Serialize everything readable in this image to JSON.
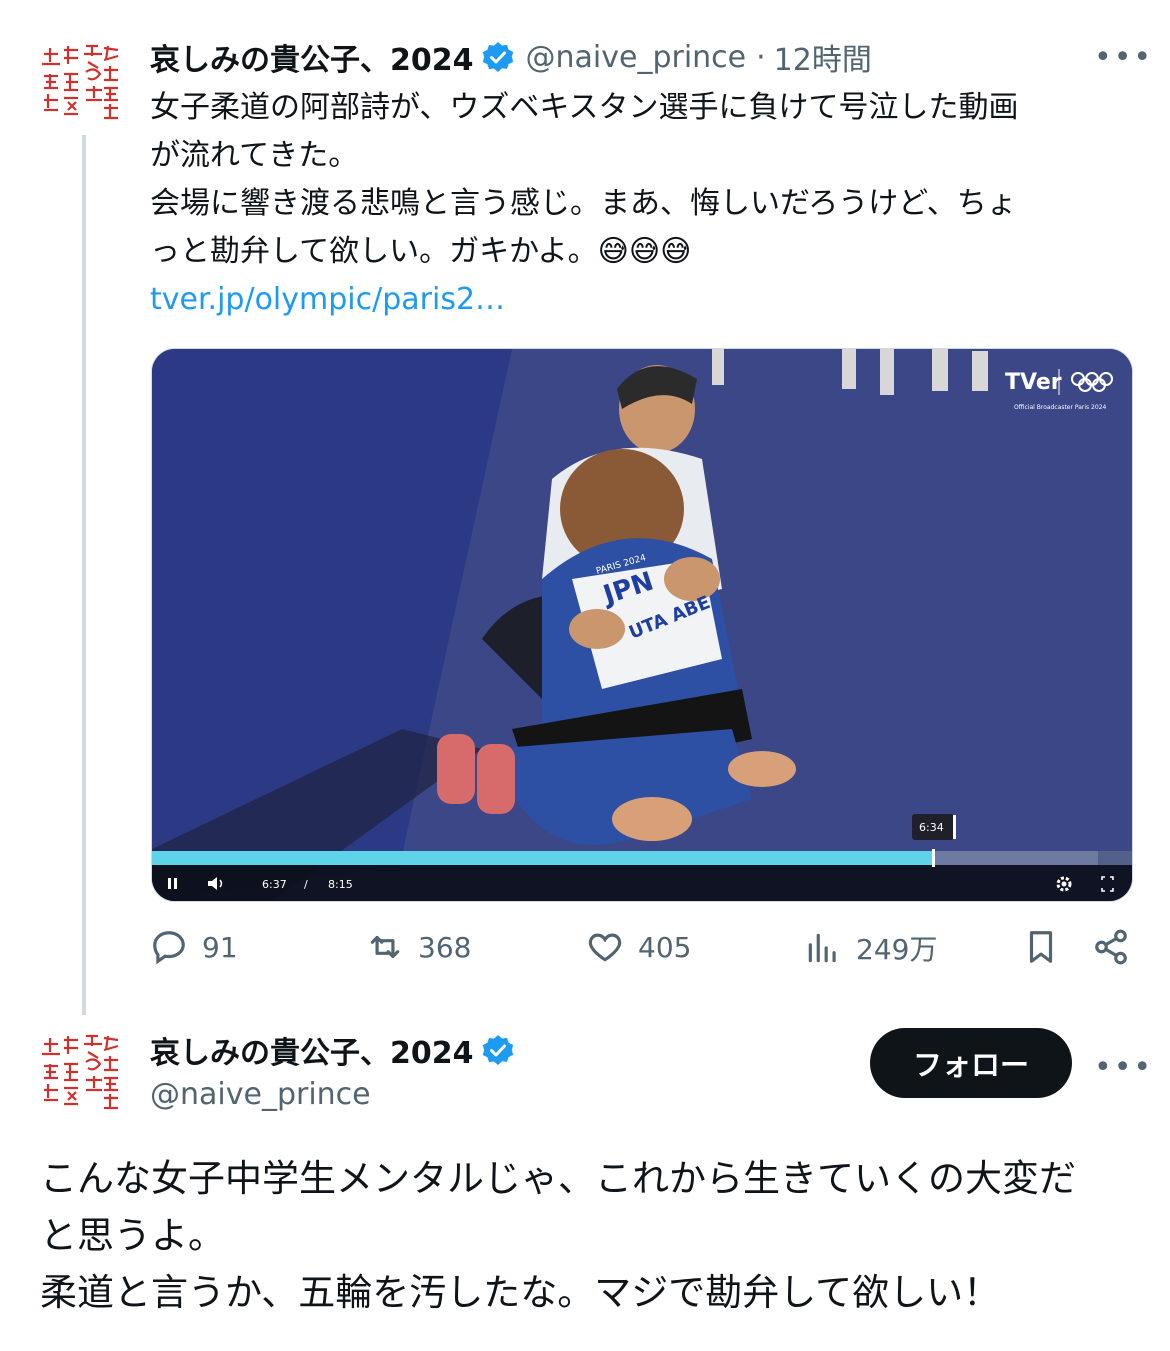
{
  "quoted_tweet": {
    "display_name": "哀しみの貴公子、2024",
    "handle": "@naive_prince",
    "separator": "·",
    "time": "12時間",
    "more": "•••",
    "text_lines": [
      "女子柔道の阿部詩が、ウズベキスタン選手に負けて号泣した動画",
      "が流れてきた。",
      "会場に響き渡る悲鳴と言う感じ。まあ、悔しいだろうけど、ちょ",
      "っと勘弁して欲しい。ガキかよ。😅😅😅"
    ],
    "link": "tver.jp/olympic/paris2…",
    "video": {
      "channel_logo": "TVer",
      "broadcaster_note": "Official Broadcaster Paris 2024",
      "bib_country": "JPN",
      "bib_name": "UTA ABE",
      "bib_games": "PARIS 2024",
      "hover_time": "6:34",
      "current_time": "6:37",
      "time_separator": "/",
      "duration": "8:15",
      "progress_fraction": 0.797,
      "buffered_fraction": 0.965
    },
    "stats": {
      "replies": "91",
      "retweets": "368",
      "likes": "405",
      "views": "249万"
    },
    "avatar_stamp_text": "やもしの貴公子 実行委員会"
  },
  "main_tweet": {
    "display_name": "哀しみの貴公子、2024",
    "handle": "@naive_prince",
    "follow_label": "フォロー",
    "more": "•••",
    "text_lines": [
      "こんな女子中学生メンタルじゃ、これから生きていくの大変だ",
      "と思うよ。",
      "柔道と言うか、五輪を汚したな。マジで勘弁して欲しい！"
    ]
  },
  "colors": {
    "accent_blue": "#1d9bf0",
    "text_primary": "#0f1419",
    "text_secondary": "#536471",
    "stamp_red": "#d0312d",
    "progress_cyan": "#5fd3e8"
  }
}
